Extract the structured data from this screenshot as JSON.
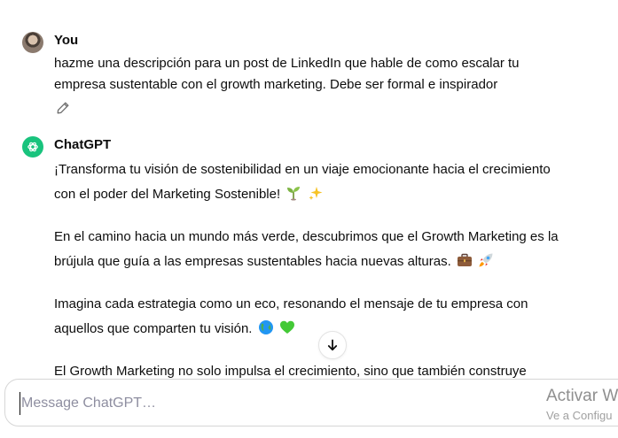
{
  "conversation": {
    "user": {
      "author": "You",
      "lines": [
        "hazme una descripción para un post de LinkedIn que hable de como escalar tu",
        "empresa sustentable con el growth marketing. Debe ser formal e inspirador"
      ]
    },
    "assistant": {
      "author": "ChatGPT",
      "paragraphs": [
        {
          "line1": "¡Transforma tu visión de sostenibilidad en un viaje emocionante hacia el crecimiento",
          "line2": "con el poder del Marketing Sostenible!",
          "emojis": [
            "seedling-icon",
            "sparkles-icon"
          ]
        },
        {
          "line1": "En el camino hacia un mundo más verde, descubrimos que el Growth Marketing es la",
          "line2": "brújula que guía a las empresas sustentables hacia nuevas alturas.",
          "emojis": [
            "briefcase-icon",
            "rocket-icon"
          ]
        },
        {
          "line1": "Imagina cada estrategia como un eco, resonando el mensaje de tu empresa con",
          "line2": "aquellos que comparten tu visión.",
          "emojis": [
            "globe-icon",
            "green-heart-icon"
          ]
        },
        {
          "line1": "El Growth Marketing no solo impulsa el crecimiento, sino que también construye"
        }
      ]
    }
  },
  "composer": {
    "placeholder": "Message ChatGPT…"
  },
  "watermark": {
    "title": "Activar W",
    "subtitle": "Ve a Configu"
  },
  "colors": {
    "brand_green": "#19c37d",
    "text": "#0d0d0d",
    "muted": "#8e8ea0"
  }
}
